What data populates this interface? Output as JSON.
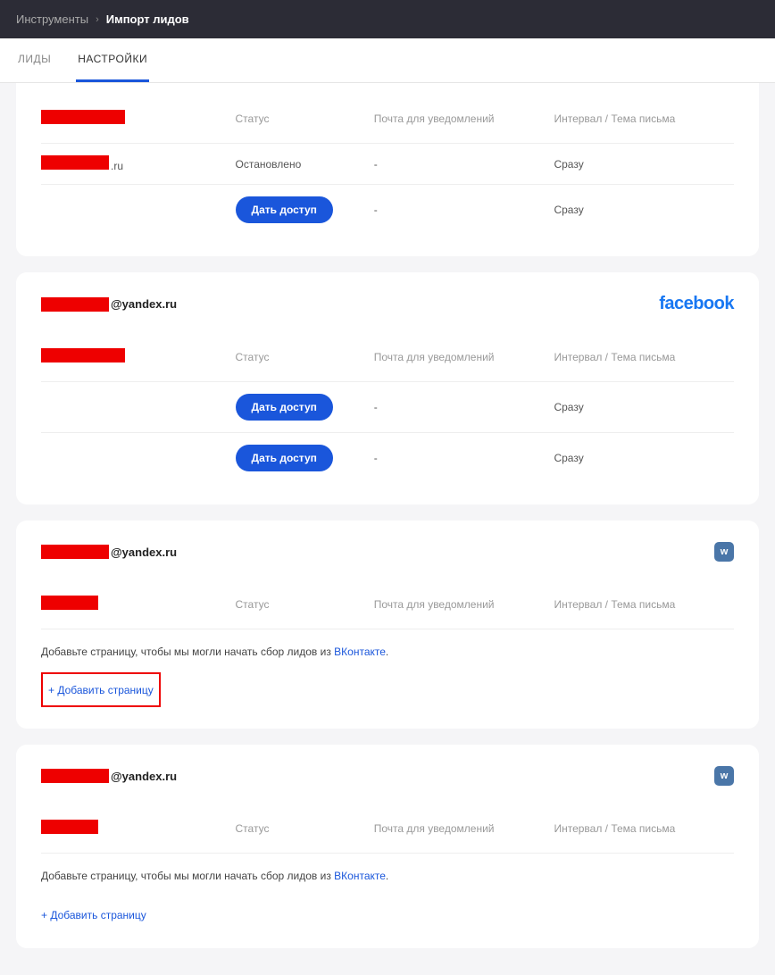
{
  "breadcrumb": {
    "parent": "Инструменты",
    "current": "Импорт лидов"
  },
  "tabs": {
    "leads": "ЛИДЫ",
    "settings": "НАСТРОЙКИ"
  },
  "columns": {
    "status": "Статус",
    "email": "Почта для уведомлений",
    "interval": "Интервал / Тема письма"
  },
  "card1": {
    "rows": [
      {
        "name_suffix": ".ru",
        "status": "Остановлено",
        "email": "-",
        "interval": "Сразу"
      },
      {
        "status_button": "Дать доступ",
        "email": "-",
        "interval": "Сразу"
      }
    ]
  },
  "card2": {
    "email_suffix": "@yandex.ru",
    "platform": "facebook",
    "rows": [
      {
        "status_button": "Дать доступ",
        "email": "-",
        "interval": "Сразу"
      },
      {
        "status_button": "Дать доступ",
        "email": "-",
        "interval": "Сразу"
      }
    ]
  },
  "card3": {
    "email_suffix": "@yandex.ru",
    "platform": "vk",
    "vk_label": "w",
    "hint_prefix": "Добавьте страницу, чтобы мы могли начать сбор лидов из ",
    "hint_link": "ВКонтакте",
    "hint_suffix": ".",
    "add_page": "+ Добавить страницу"
  },
  "card4": {
    "email_suffix": "@yandex.ru",
    "platform": "vk",
    "vk_label": "w",
    "hint_prefix": "Добавьте страницу, чтобы мы могли начать сбор лидов из ",
    "hint_link": "ВКонтакте",
    "hint_suffix": ".",
    "add_page": "+ Добавить страницу"
  }
}
